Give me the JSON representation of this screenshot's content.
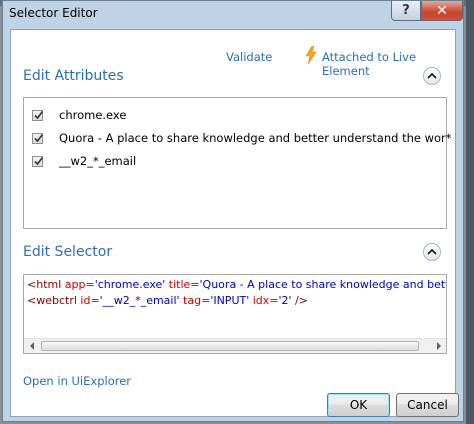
{
  "window": {
    "title": "Selector Editor"
  },
  "titlebar": {
    "help_glyph": "?",
    "close_glyph": "✕"
  },
  "toolbar": {
    "validate_label": "Validate",
    "attached_label": "Attached to Live Element"
  },
  "attributes": {
    "header": "Edit Attributes",
    "items": [
      {
        "label": "chrome.exe",
        "checked": true
      },
      {
        "label": "Quora - A place to share knowledge and better understand the wor*",
        "checked": true
      },
      {
        "label": "__w2_*_email",
        "checked": true
      }
    ]
  },
  "selector": {
    "header": "Edit Selector",
    "line1": {
      "open": "<html ",
      "a1": "app=",
      "v1": "'chrome.exe'",
      "a2": " title=",
      "v2": "'Quora - A place to share knowledge and better unde"
    },
    "line2": {
      "open": "<webctrl ",
      "a1": "id=",
      "v1": "'__w2_*_email'",
      "a2": " tag=",
      "v2": "'INPUT'",
      "a3": " idx=",
      "v3": "'2'",
      "close": " />"
    }
  },
  "footer": {
    "open_link": "Open in UiExplorer",
    "ok_label": "OK",
    "cancel_label": "Cancel"
  },
  "icons": {
    "bolt": "lightning-bolt",
    "collapse": "chevron-up"
  },
  "colors": {
    "accent": "#2a6fb1",
    "bolt": "#f5a623",
    "close": "#c7452c"
  }
}
